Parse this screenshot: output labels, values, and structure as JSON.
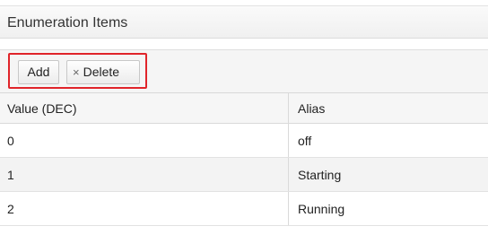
{
  "panel": {
    "title": "Enumeration Items"
  },
  "toolbar": {
    "add_label": "Add",
    "delete_icon": "×",
    "delete_label": "Delete",
    "highlight_color": "#e0242a"
  },
  "table": {
    "columns": [
      "Value (DEC)",
      "Alias"
    ],
    "rows": [
      {
        "value": "0",
        "alias": "off"
      },
      {
        "value": "1",
        "alias": "Starting"
      },
      {
        "value": "2",
        "alias": "Running"
      }
    ]
  }
}
